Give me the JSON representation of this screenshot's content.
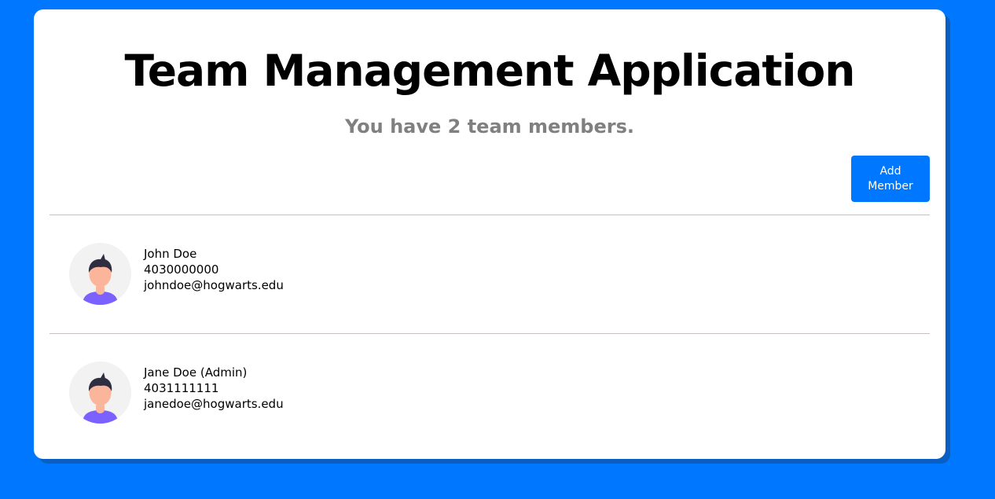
{
  "app": {
    "title": "Team Management Application",
    "subtitle": "You have 2 team members."
  },
  "toolbar": {
    "add_member_label": "Add Member"
  },
  "members": [
    {
      "name": "John Doe",
      "phone": "4030000000",
      "email": "johndoe@hogwarts.edu",
      "avatar_icon": "user-avatar-icon"
    },
    {
      "name": "Jane Doe (Admin)",
      "phone": "4031111111",
      "email": "janedoe@hogwarts.edu",
      "avatar_icon": "user-avatar-icon"
    }
  ],
  "colors": {
    "background": "#0077ff",
    "card": "#ffffff",
    "button": "#0077ff",
    "subtitle": "#808080"
  }
}
